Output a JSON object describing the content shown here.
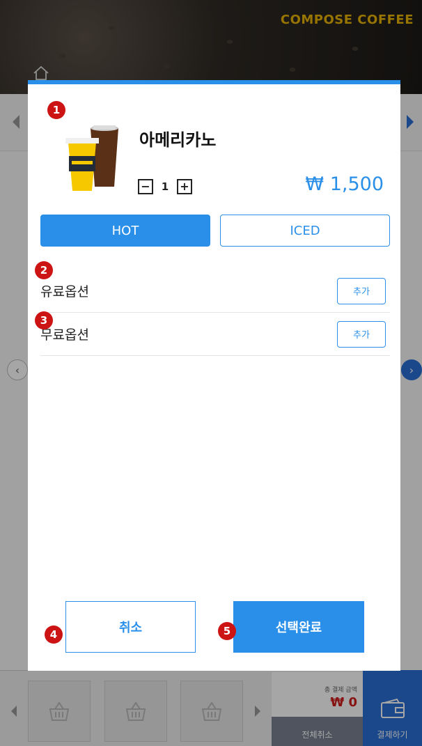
{
  "app": {
    "brand": "COMPOSE COFFEE"
  },
  "modal": {
    "product_name": "아메리카노",
    "quantity": "1",
    "price": "₩ 1,500",
    "temp_options": [
      "HOT",
      "ICED"
    ],
    "selected_temp": "HOT",
    "options": [
      {
        "label": "유료옵션",
        "button": "추가"
      },
      {
        "label": "무료옵션",
        "button": "추가"
      }
    ],
    "cancel_label": "취소",
    "confirm_label": "선택완료"
  },
  "cart": {
    "total_label": "총 결제 금액",
    "total_amount": "₩ 0",
    "clear_all_label": "전체취소",
    "pay_label": "결제하기"
  },
  "markers": [
    "1",
    "2",
    "3",
    "4",
    "5"
  ],
  "colors": {
    "accent": "#2a8fe8",
    "brand": "#e8b400",
    "marker": "#cc1414",
    "price_zero": "#d01c1c"
  },
  "icons": {
    "home": "home-icon",
    "basket": "basket-icon",
    "wallet": "wallet-icon"
  }
}
